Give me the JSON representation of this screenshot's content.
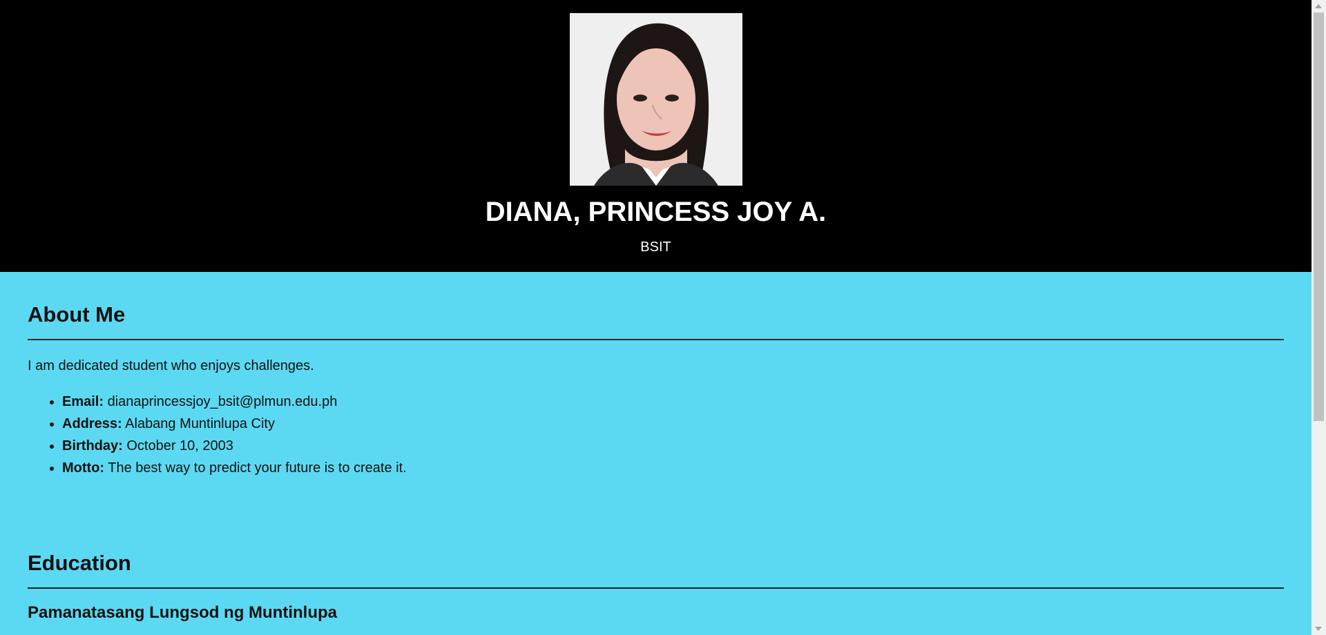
{
  "header": {
    "name": "DIANA, PRINCESS JOY A.",
    "course": "BSIT",
    "photo_icon": "profile-photo"
  },
  "about": {
    "title": "About Me",
    "intro": "I am dedicated student who enjoys challenges.",
    "items": [
      {
        "label": "Email:",
        "value": "dianaprincessjoy_bsit@plmun.edu.ph"
      },
      {
        "label": "Address:",
        "value": "Alabang Muntinlupa City"
      },
      {
        "label": "Birthday:",
        "value": "October 10, 2003"
      },
      {
        "label": "Motto:",
        "value": "The best way to predict your future is to create it."
      }
    ]
  },
  "education": {
    "title": "Education",
    "school": "Pamanatasang Lungsod ng Muntinlupa"
  },
  "colors": {
    "header_bg": "#000000",
    "page_bg": "#5bd9f2",
    "text": "#111111"
  }
}
